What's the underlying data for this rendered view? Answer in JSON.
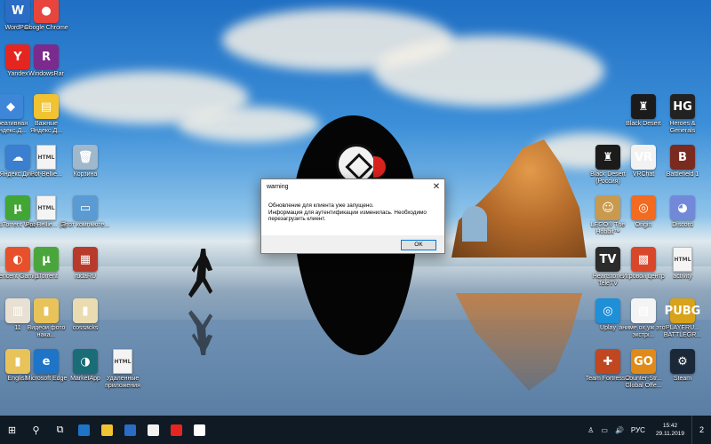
{
  "desktop": {
    "left_icons": [
      {
        "label": "WordPad",
        "color": "#2b6cc4",
        "glyph": "W"
      },
      {
        "label": "Google Chrome",
        "color": "#e8453c",
        "glyph": "●"
      },
      {
        "label": "Yandex",
        "color": "#e52620",
        "glyph": "Y"
      },
      {
        "label": "WindowsRar",
        "color": "#7b2a8e",
        "glyph": "R"
      },
      {
        "label": "Креативная Яндекс.Д...",
        "color": "#3d86d8",
        "glyph": "◆"
      },
      {
        "label": "Важные Яндекс.Д...",
        "color": "#f1c232",
        "glyph": "▤"
      },
      {
        "label": "Яндекс.Диск",
        "color": "#3b7fd0",
        "glyph": "☁"
      },
      {
        "label": "Pot-Bellie...",
        "color": "#f4f4f4",
        "glyph": "HTML"
      },
      {
        "label": "Корзина",
        "color": "#9fb8cc",
        "glyph": "🗑"
      },
      {
        "label": "uTorrent Web",
        "color": "#41a634",
        "glyph": "µ"
      },
      {
        "label": "Pot-Bellie... (1)",
        "color": "#f4f4f4",
        "glyph": "HTML"
      },
      {
        "label": "Этот компьюте...",
        "color": "#5a9bd4",
        "glyph": "▭"
      },
      {
        "label": "Tencent Gami...",
        "color": "#e6502a",
        "glyph": "◐"
      },
      {
        "label": "µTorrent",
        "color": "#4aa63c",
        "glyph": "µ"
      },
      {
        "label": "rudaRU",
        "color": "#b83a2a",
        "glyph": "▦"
      },
      {
        "label": "11",
        "color": "#e8e0d2",
        "glyph": "▥"
      },
      {
        "label": "Видеои фото нака...",
        "color": "#e8c35a",
        "glyph": "▮"
      },
      {
        "label": "cossacks",
        "color": "#eadcb0",
        "glyph": "▮"
      },
      {
        "label": "English",
        "color": "#e8c35a",
        "glyph": "▮"
      },
      {
        "label": "Microsoft Edge",
        "color": "#1e74c6",
        "glyph": "e"
      },
      {
        "label": "MarketApp",
        "color": "#1a6c77",
        "glyph": "◑"
      },
      {
        "label": "Удаленные приложения",
        "color": "#f4f4f4",
        "glyph": "HTML"
      }
    ],
    "right_icons": [
      {
        "label": "Black Desert",
        "color": "#1b1b1b",
        "glyph": "♜"
      },
      {
        "label": "Heroes & Generals",
        "color": "#222222",
        "glyph": "HG"
      },
      {
        "label": "Black Desert (Россия)",
        "color": "#1b1b1b",
        "glyph": "♜"
      },
      {
        "label": "VRChat",
        "color": "#f2f2f2",
        "glyph": "VR"
      },
      {
        "label": "Battlefield 1",
        "color": "#7a2a1f",
        "glyph": "B"
      },
      {
        "label": "LEGO® The Hobbit™",
        "color": "#c99a4d",
        "glyph": "☺"
      },
      {
        "label": "Origin",
        "color": "#f26b21",
        "glyph": "◎"
      },
      {
        "label": "Discord",
        "color": "#7289da",
        "glyph": "◕"
      },
      {
        "label": "Heartstone TeleTV",
        "color": "#2b2b2b",
        "glyph": "TV"
      },
      {
        "label": "Игровой центр",
        "color": "#d9472b",
        "glyph": "▩"
      },
      {
        "label": "activity",
        "color": "#f4f4f4",
        "glyph": "HTML"
      },
      {
        "label": "Uplay",
        "color": "#1f8fd8",
        "glyph": "◎"
      },
      {
        "label": "аниме.ох уж этот экстрі...",
        "color": "#f4f4f4",
        "glyph": "▤"
      },
      {
        "label": "PLAYERU... BATTLEGR...",
        "color": "#d8a21b",
        "glyph": "PUBG"
      },
      {
        "label": "Team Fortress 2",
        "color": "#c0471f",
        "glyph": "✚"
      },
      {
        "label": "Counter-Str... Global Offe...",
        "color": "#e08b19",
        "glyph": "GO"
      },
      {
        "label": "Steam",
        "color": "#1b2838",
        "glyph": "⚙"
      }
    ]
  },
  "dialog": {
    "title": "warning",
    "line1": "Обновление для клиента уже запущено.",
    "line2": "Информация для аутентификации изменилась. Необходимо",
    "line3": "перезагрузить клиент.",
    "ok_label": "OK",
    "close_glyph": "✕"
  },
  "taskbar": {
    "start_glyph": "⊞",
    "search_glyph": "⚲",
    "taskview_glyph": "⧉",
    "pinned": [
      {
        "name": "edge-app",
        "color": "#1e74c6"
      },
      {
        "name": "explorer-app",
        "color": "#f1c232"
      },
      {
        "name": "store-app",
        "color": "#2b6cc4"
      },
      {
        "name": "mail-app",
        "color": "#f2f2f2"
      },
      {
        "name": "yandex-app-1",
        "color": "#e52620"
      },
      {
        "name": "yandex-app-2",
        "color": "#ffffff"
      }
    ],
    "tray": {
      "people_glyph": "♙",
      "volume_glyph": "🔊",
      "network_glyph": "▭",
      "language": "РУС",
      "time": "15:42",
      "date": "29.11.2019",
      "notification_glyph": "▢",
      "badge": "2"
    }
  }
}
